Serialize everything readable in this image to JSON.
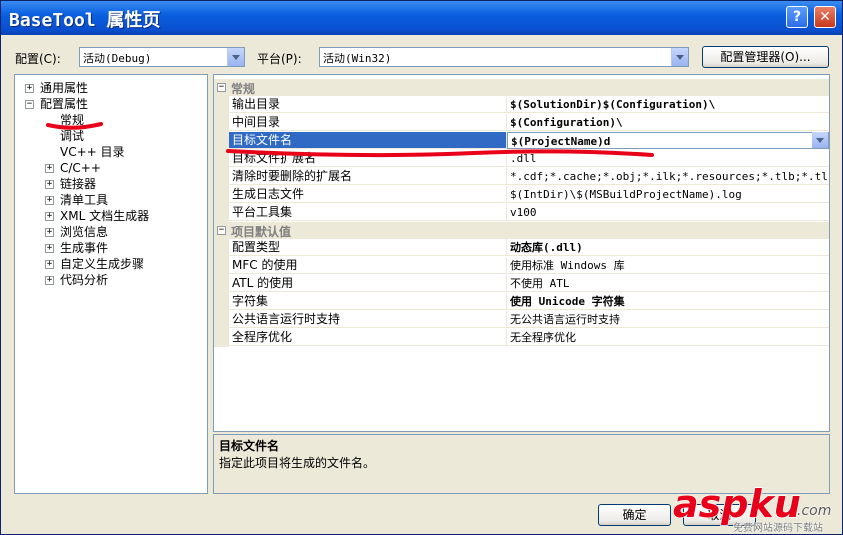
{
  "window": {
    "title": "BaseTool 属性页"
  },
  "titlebar": {
    "help_label": "?",
    "close_label": "✕"
  },
  "toolbar": {
    "config_label": "配置(C):",
    "config_value": "活动(Debug)",
    "platform_label": "平台(P):",
    "platform_value": "活动(Win32)",
    "manager_button": "配置管理器(O)..."
  },
  "tree": {
    "items": [
      {
        "label": "通用属性",
        "expander": "+"
      },
      {
        "label": "配置属性",
        "expander": "−"
      },
      {
        "label": "常规"
      },
      {
        "label": "调试"
      },
      {
        "label": "VC++ 目录"
      },
      {
        "label": "C/C++",
        "expander": "+"
      },
      {
        "label": "链接器",
        "expander": "+"
      },
      {
        "label": "清单工具",
        "expander": "+"
      },
      {
        "label": "XML 文档生成器",
        "expander": "+"
      },
      {
        "label": "浏览信息",
        "expander": "+"
      },
      {
        "label": "生成事件",
        "expander": "+"
      },
      {
        "label": "自定义生成步骤",
        "expander": "+"
      },
      {
        "label": "代码分析",
        "expander": "+"
      }
    ]
  },
  "grid": {
    "categories": [
      {
        "label": "常规",
        "expander": "−"
      },
      {
        "label": "项目默认值",
        "expander": "−"
      }
    ],
    "general_rows": [
      {
        "name": "输出目录",
        "value": "$(SolutionDir)$(Configuration)\\"
      },
      {
        "name": "中间目录",
        "value": "$(Configuration)\\"
      },
      {
        "name": "目标文件名",
        "value": "$(ProjectName)d"
      },
      {
        "name": "目标文件扩展名",
        "value": ".dll"
      },
      {
        "name": "清除时要删除的扩展名",
        "value": "*.cdf;*.cache;*.obj;*.ilk;*.resources;*.tlb;*.tli;*.tlh;*.tmp;*.rsp"
      },
      {
        "name": "生成日志文件",
        "value": "$(IntDir)\\$(MSBuildProjectName).log"
      },
      {
        "name": "平台工具集",
        "value": "v100"
      }
    ],
    "default_rows": [
      {
        "name": "配置类型",
        "value": "动态库(.dll)"
      },
      {
        "name": "MFC 的使用",
        "value": "使用标准 Windows 库"
      },
      {
        "name": "ATL 的使用",
        "value": "不使用 ATL"
      },
      {
        "name": "字符集",
        "value": "使用 Unicode 字符集"
      },
      {
        "name": "公共语言运行时支持",
        "value": "无公共语言运行时支持"
      },
      {
        "name": "全程序优化",
        "value": "无全程序优化"
      }
    ]
  },
  "description": {
    "title": "目标文件名",
    "text": "指定此项目将生成的文件名。"
  },
  "footer": {
    "ok_label": "确定",
    "cancel_label": "取消"
  },
  "watermark": {
    "brand": "aspku",
    "suffix": ".com",
    "tagline": "免费网站源码下载站"
  },
  "colors": {
    "annotation": "#e8001a",
    "selection": "#316ac5",
    "title_bar": "#0a5fe0"
  }
}
